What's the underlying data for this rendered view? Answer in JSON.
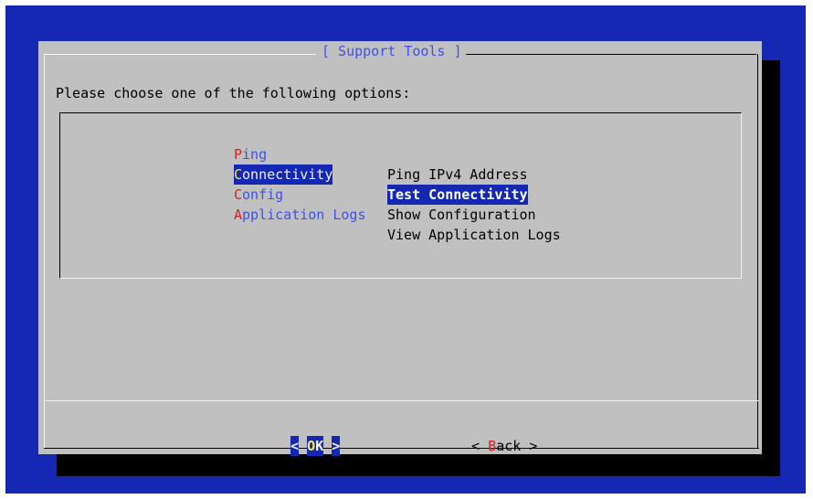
{
  "dialog": {
    "title": "[ Support Tools ]",
    "prompt": "Please choose one of the following options:"
  },
  "menu": {
    "items": [
      {
        "tag_hotkey": "P",
        "tag_rest": "ing",
        "description": "Ping IPv4 Address",
        "selected": false
      },
      {
        "tag_hotkey": "C",
        "tag_rest": "onnectivity",
        "description": "Test Connectivity",
        "selected": true
      },
      {
        "tag_hotkey": "C",
        "tag_rest": "onfig",
        "description": "Show Configuration",
        "selected": false
      },
      {
        "tag_hotkey": "A",
        "tag_rest": "pplication Logs",
        "description": "View Application Logs",
        "selected": false
      }
    ]
  },
  "buttons": {
    "ok": {
      "left": "<",
      "hotkey": "O",
      "rest": "K",
      "right": ">"
    },
    "back": {
      "left": "< ",
      "hotkey": "B",
      "rest": "ack",
      "right": " >"
    }
  },
  "colors": {
    "terminal_bg": "#1428b4",
    "dialog_bg": "#c0c0c0",
    "tag_text": "#3d52e8",
    "hotkey": "#d42020",
    "selected_hotkey": "#ffeb3b"
  }
}
